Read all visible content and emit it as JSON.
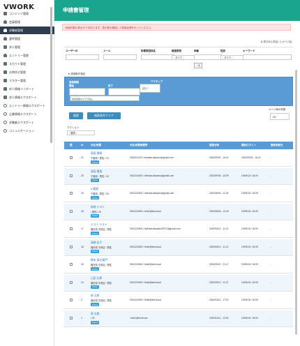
{
  "app": {
    "logo": "VWORK",
    "page_title": "申請書管理"
  },
  "sidebar": {
    "items": [
      {
        "label": "コンテンツ管理",
        "icon": "grid-icon",
        "has_chevron": true
      },
      {
        "label": "会員管理",
        "icon": "users-icon"
      },
      {
        "label": "求職者管理",
        "icon": "users-icon",
        "active": true
      },
      {
        "label": "選考管理",
        "icon": "person-icon"
      },
      {
        "label": "求人管理",
        "icon": "briefcase-icon"
      },
      {
        "label": "エントリー管理",
        "icon": "person-icon"
      },
      {
        "label": "スカウト管理",
        "icon": "mail-icon"
      },
      {
        "label": "お問合せ管理",
        "icon": "mail-icon"
      },
      {
        "label": "マスター管理",
        "icon": "gear-icon",
        "has_chevron": true
      },
      {
        "label": "求人情報インポート",
        "icon": "import-icon"
      },
      {
        "label": "求人情報エクスポート",
        "icon": "export-icon"
      },
      {
        "label": "エントリー情報エクスポート",
        "icon": "circle-icon"
      },
      {
        "label": "企業情報エクスポート",
        "icon": "circle-icon"
      },
      {
        "label": "求職者エクスポート",
        "icon": "circle-icon"
      },
      {
        "label": "コミュニケーション",
        "icon": "circle-icon",
        "has_chevron": true
      }
    ]
  },
  "alert": {
    "text": "検索件数の表示が 3 件あります。表示数を確認して検索処理を行ってください。"
  },
  "pager_top": {
    "text": "11 件中の1 件目 / 1 ページ目"
  },
  "filters": {
    "user_code": {
      "label": "ユーザーID"
    },
    "mail": {
      "label": "メール"
    },
    "applicant_name": {
      "label": "所属等団体名"
    },
    "status": {
      "label": "都道府県",
      "value": "- すべて -"
    },
    "year": {
      "label": "年齢",
      "chip": "一括"
    },
    "gender": {
      "label": "性別",
      "value": "- すべて -"
    },
    "keyword": {
      "label": "キーワード"
    }
  },
  "detail_toggle": {
    "label": "▼ 詳細条件指定"
  },
  "detail": {
    "date_label_1": "登録期間",
    "date_label_1b": "開始",
    "date_label_2": "終了",
    "active_label": "アクティブ",
    "active_value": "はい",
    "sub_text": "検索範囲を以下で絞込"
  },
  "buttons": {
    "search": "検索",
    "clear": "検索条件クリア"
  },
  "per_page": {
    "label": "ページ毎の件数",
    "value": "20"
  },
  "action": {
    "label": "アクション",
    "select": "- 選択 -"
  },
  "table": {
    "headers": [
      "選",
      "ID",
      "氏名/所属",
      "氏名/所属時間帯",
      "登録日時",
      "最終ログイン",
      "最終更新日"
    ],
    "rows": [
      {
        "id": "21",
        "name": "高坂 陽翔",
        "sub": "千葉県 / 男性 / 20",
        "badge": "Active",
        "email": "0000011123 / lsehaka.takaoko@gmail.com",
        "d1": "2020/09/20 - 16:21",
        "d2": "2020/09/20 - 16:21",
        "d3": "-"
      },
      {
        "id": "20",
        "name": "高坂 陽翔",
        "sub": "千葉県 / 男性 / 20",
        "badge": "Active",
        "email": "0001234000 / lsehaka.takaoko@gmail.com",
        "d1": "2020/09/06 - 15:59",
        "d2": "19/09/18 / 16:09",
        "d3": "-"
      },
      {
        "id": "19",
        "name": "a 陽優",
        "sub": "千葉県 / 男性 / 25",
        "badge": "Active",
        "email": "0001234000 / lsehaka.takaoko@gmail.com",
        "d1": "2020/08/03 - 11:40",
        "d2": "19/09/18 / 16:09",
        "d3": "-"
      },
      {
        "id": "18",
        "name": "新規 テスト",
        "sub": "/ 男性 / 20",
        "badge": "Active",
        "email": "0001234000 / test2@test.local",
        "d1": "2020/08/18 - 13:40",
        "d2": "19/09/18 / 16:09",
        "d3": "-"
      },
      {
        "id": "17",
        "name": "テスト テスト",
        "sub": "福島県 中央区 / 男性",
        "badge": "Active",
        "email": "0001234000 / lsehaka.takaoko20071@gmail.com",
        "d1": "2020/05/12 - 11:12",
        "d2": "19/09/18 / 16:09",
        "d3": "-"
      },
      {
        "id": "16",
        "name": "高橋 花子",
        "sub": "福島県 中央区 / 男性",
        "badge": "Active",
        "email": "0001234000 / test2@test.local",
        "d1": "2020/05/12 - 11:12",
        "d2": "19/09/18 / 16:09",
        "d3": "-"
      },
      {
        "id": "15",
        "name": "橋本 真左衛門",
        "sub": "福島県 中央区 / 男性",
        "badge": "Active",
        "email": "0001234000 / test3@test.local",
        "d1": "2020/05/12 - 11:17",
        "d2": "19/09/18 / 16:09",
        "d3": "-"
      },
      {
        "id": "14",
        "name": "山田 太郎",
        "sub": "福島県 中央区 / 男性",
        "badge": "Active",
        "email": "0001234000 / test4@test.local",
        "d1": "2020/05/12 - 11:27",
        "d2": "19/09/18 / 16:09",
        "d3": "-"
      },
      {
        "id": "2",
        "name": "原 太郎",
        "sub": "福島県 中央区 / 男性",
        "badge": "Active",
        "email": "0001234000 / test5@test.local",
        "d1": "2020/04/11 - 17:20",
        "d2": "19/09/18 / 16:09",
        "d3": "-"
      },
      {
        "id": "1",
        "name": "原 太郎",
        "sub": "/ 30",
        "badge": "Active",
        "email": "/ test1@test.local",
        "d1": "2020/04/11 - 12:00",
        "d2": "19/09/18 / 16:09",
        "d3": "-"
      }
    ]
  }
}
